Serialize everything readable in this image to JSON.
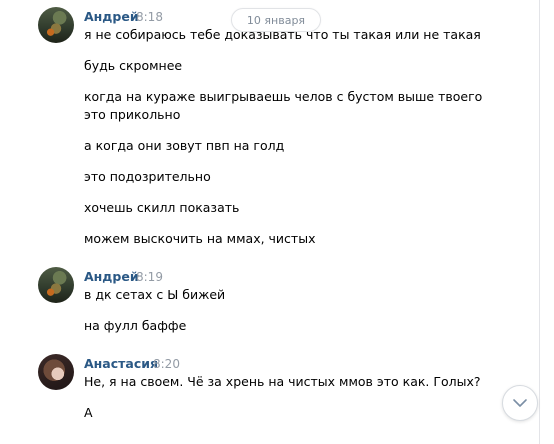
{
  "date_separator": "10 января",
  "groups": [
    {
      "author": "Андрей",
      "time": "8:18",
      "avatar": "andrey-avatar",
      "messages": [
        "я не собираюсь тебе доказывать что ты такая или не такая",
        "будь скромнее",
        "когда на кураже выигрываешь челов с бустом выше твоего",
        "это прикольно",
        "а когда они зовут пвп на голд",
        "это подозрительно",
        "хочешь скилл показать",
        "можем выскочить на ммах, чистых"
      ]
    },
    {
      "author": "Андрей",
      "time": "8:19",
      "avatar": "andrey-avatar",
      "messages": [
        "в дк сетах с Ы бижей",
        "на фулл баффе"
      ]
    },
    {
      "author": "Анастасия",
      "time": "8:20",
      "avatar": "anastasia-avatar",
      "messages": [
        "Не, я на своем. Чё за хрень на чистых ммов это как. Голых?",
        "А"
      ]
    }
  ],
  "scroll_button_icon": "chevron-down-icon",
  "colors": {
    "author": "#2a5885",
    "time": "#939ba5",
    "text": "#000000",
    "date_pill_text": "#818c99"
  }
}
